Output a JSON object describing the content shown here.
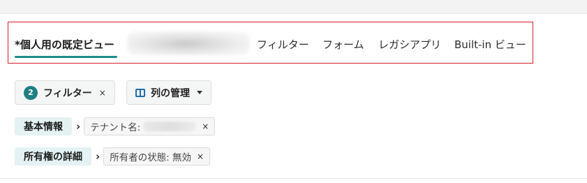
{
  "tabs": [
    {
      "label": "*個人用の既定ビュー",
      "active": true
    },
    {
      "label": "",
      "redacted": true
    },
    {
      "label": "フィルター"
    },
    {
      "label": "フォーム"
    },
    {
      "label": "レガシアプリ"
    },
    {
      "label": "Built-in ビュー"
    }
  ],
  "toolbar": {
    "filter_count": "2",
    "filter_label": "フィルター",
    "filter_clear": "×",
    "columns_label": "列の管理"
  },
  "filter_groups": [
    {
      "category": "基本情報",
      "chip_label": "テナント名:",
      "chip_value_redacted": true,
      "close": "×"
    },
    {
      "category": "所有権の詳細",
      "chip_label": "所有者の状態: 無効",
      "close": "×"
    }
  ],
  "colors": {
    "accent": "#1f8a8a",
    "highlight_box": "#d21f2b",
    "badge": "#1f7f82"
  }
}
